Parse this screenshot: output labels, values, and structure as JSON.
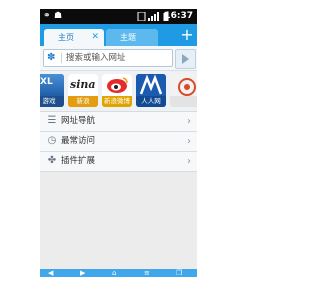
{
  "status_bar": {
    "time": "16:37"
  },
  "tabs": [
    {
      "label": "主页",
      "active": true
    },
    {
      "label": "主题",
      "active": false
    }
  ],
  "add_tab_icon": "plus-icon",
  "search": {
    "placeholder": "搜索或输入网址"
  },
  "speed_dial": [
    {
      "name": "游戏",
      "color": "#2b6fb8"
    },
    {
      "name": "新浪",
      "logo_text": "sina",
      "color": "#f3b316"
    },
    {
      "name": "新浪微博",
      "color": "#f0c400"
    },
    {
      "name": "人人网",
      "color": "#1a5bb0"
    },
    {
      "name": "",
      "color": "#f2f2f2"
    }
  ],
  "menu": [
    {
      "label": "网址导航",
      "icon": "navigation-icon"
    },
    {
      "label": "最常访问",
      "icon": "clock-icon"
    },
    {
      "label": "插件扩展",
      "icon": "puzzle-icon"
    }
  ],
  "colors": {
    "accent": "#1e9be4",
    "toolbar": "#3fa7ea"
  }
}
